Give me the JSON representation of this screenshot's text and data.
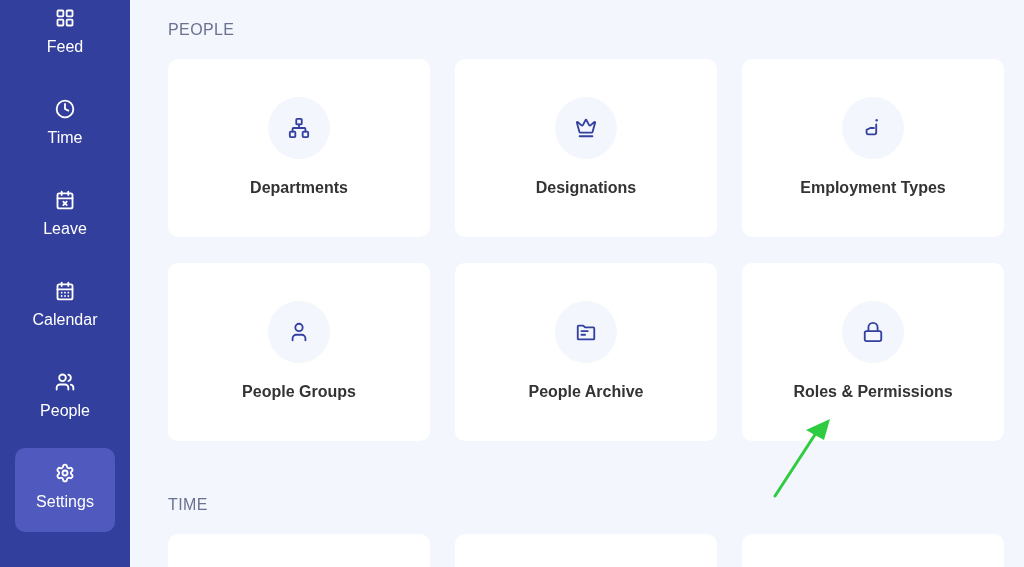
{
  "sidebar": {
    "items": [
      {
        "label": "Feed",
        "selected": false
      },
      {
        "label": "Time",
        "selected": false
      },
      {
        "label": "Leave",
        "selected": false
      },
      {
        "label": "Calendar",
        "selected": false
      },
      {
        "label": "People",
        "selected": false
      },
      {
        "label": "Settings",
        "selected": true
      }
    ]
  },
  "sections": [
    {
      "title": "PEOPLE",
      "cards": [
        {
          "label": "Departments"
        },
        {
          "label": "Designations"
        },
        {
          "label": "Employment Types"
        },
        {
          "label": "People Groups"
        },
        {
          "label": "People Archive"
        },
        {
          "label": "Roles & Permissions"
        }
      ]
    },
    {
      "title": "TIME"
    }
  ]
}
